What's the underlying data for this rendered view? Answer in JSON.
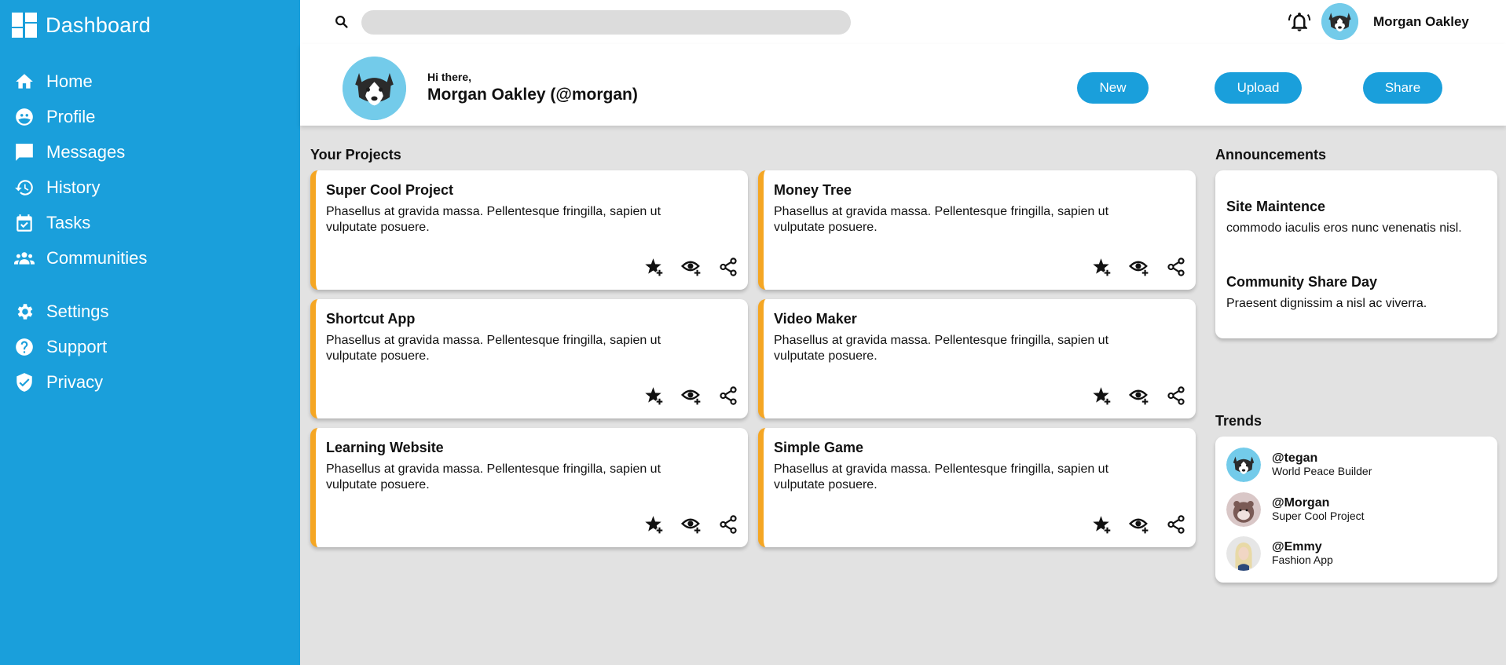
{
  "app": {
    "title": "Dashboard"
  },
  "sidebar": {
    "items": [
      {
        "label": "Home",
        "icon": "home-icon"
      },
      {
        "label": "Profile",
        "icon": "profile-icon"
      },
      {
        "label": "Messages",
        "icon": "message-icon"
      },
      {
        "label": "History",
        "icon": "history-icon"
      },
      {
        "label": "Tasks",
        "icon": "tasks-icon"
      },
      {
        "label": "Communities",
        "icon": "communities-icon"
      },
      {
        "label": "Settings",
        "icon": "gear-icon"
      },
      {
        "label": "Support",
        "icon": "help-icon"
      },
      {
        "label": "Privacy",
        "icon": "shield-icon"
      }
    ]
  },
  "topbar": {
    "search_placeholder": "",
    "username": "Morgan Oakley"
  },
  "header": {
    "greeting": "Hi there,",
    "name": "Morgan Oakley (@morgan)",
    "buttons": {
      "new": "New",
      "upload": "Upload",
      "share": "Share"
    }
  },
  "projects": {
    "title": "Your Projects",
    "items": [
      {
        "title": "Super Cool Project",
        "desc": "Phasellus at gravida massa. Pellentesque fringilla, sapien ut vulputate posuere."
      },
      {
        "title": "Money Tree",
        "desc": "Phasellus at gravida massa. Pellentesque fringilla, sapien ut vulputate posuere."
      },
      {
        "title": "Shortcut App",
        "desc": "Phasellus at gravida massa. Pellentesque fringilla, sapien ut vulputate posuere."
      },
      {
        "title": "Video Maker",
        "desc": "Phasellus at gravida massa. Pellentesque fringilla, sapien ut vulputate posuere."
      },
      {
        "title": "Learning Website",
        "desc": "Phasellus at gravida massa. Pellentesque fringilla, sapien ut vulputate posuere."
      },
      {
        "title": "Simple Game",
        "desc": "Phasellus at gravida massa. Pellentesque fringilla, sapien ut vulputate posuere."
      }
    ]
  },
  "announcements": {
    "title": "Announcements",
    "items": [
      {
        "title": "Site Maintence",
        "body": "commodo iaculis eros nunc venenatis nisl."
      },
      {
        "title": "Community Share Day",
        "body": "Praesent dignissim a nisl ac viverra."
      }
    ]
  },
  "trends": {
    "title": "Trends",
    "items": [
      {
        "handle": "@tegan",
        "project": "World Peace Builder"
      },
      {
        "handle": "@Morgan",
        "project": "Super Cool Project"
      },
      {
        "handle": "@Emmy",
        "project": "Fashion App"
      }
    ]
  },
  "colors": {
    "sidebar": "#1a9fdb",
    "accent": "#1a9fdb",
    "card_border": "#f5a623",
    "background": "#e2e2e2",
    "avatar_bg": "#73cbea"
  }
}
